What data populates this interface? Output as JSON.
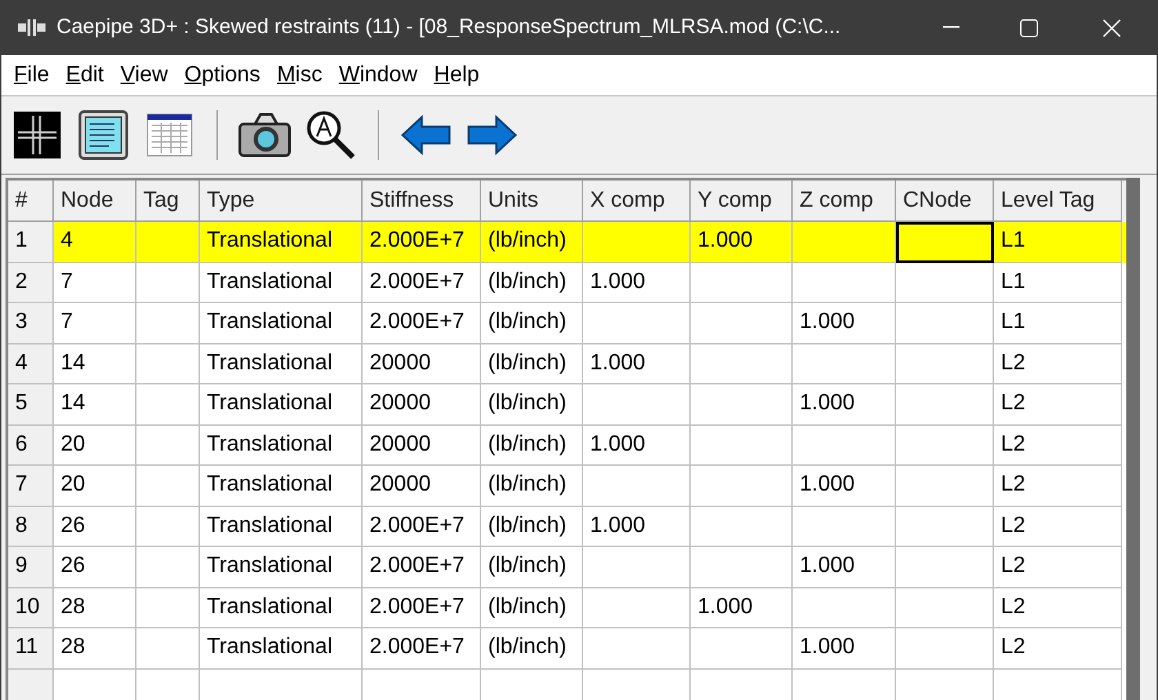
{
  "window": {
    "title": "Caepipe 3D+ : Skewed restraints  (11)  -  [08_ResponseSpectrum_MLRSA.mod (C:\\C..."
  },
  "menu": [
    "File",
    "Edit",
    "View",
    "Options",
    "Misc",
    "Window",
    "Help"
  ],
  "toolbar": [
    {
      "kind": "grid"
    },
    {
      "kind": "list"
    },
    {
      "kind": "table"
    },
    {
      "kind": "sep"
    },
    {
      "kind": "camera"
    },
    {
      "kind": "zoom"
    },
    {
      "kind": "sep"
    },
    {
      "kind": "back"
    },
    {
      "kind": "forward"
    }
  ],
  "table": {
    "columns": [
      "#",
      "Node",
      "Tag",
      "Type",
      "Stiffness",
      "Units",
      "X comp",
      "Y comp",
      "Z comp",
      "CNode",
      "Level Tag"
    ],
    "rows": [
      {
        "selected": true,
        "cells": [
          "1",
          "4",
          "",
          "Translational",
          "2.000E+7",
          "(lb/inch)",
          "",
          "1.000",
          "",
          "",
          "L1"
        ],
        "cell_focus": [
          false,
          false,
          false,
          false,
          false,
          false,
          false,
          false,
          false,
          true,
          false
        ]
      },
      {
        "selected": false,
        "cells": [
          "2",
          "7",
          "",
          "Translational",
          "2.000E+7",
          "(lb/inch)",
          "1.000",
          "",
          "",
          "",
          "L1"
        ]
      },
      {
        "selected": false,
        "cells": [
          "3",
          "7",
          "",
          "Translational",
          "2.000E+7",
          "(lb/inch)",
          "",
          "",
          "1.000",
          "",
          "L1"
        ]
      },
      {
        "selected": false,
        "cells": [
          "4",
          "14",
          "",
          "Translational",
          "20000",
          "(lb/inch)",
          "1.000",
          "",
          "",
          "",
          "L2"
        ]
      },
      {
        "selected": false,
        "cells": [
          "5",
          "14",
          "",
          "Translational",
          "20000",
          "(lb/inch)",
          "",
          "",
          "1.000",
          "",
          "L2"
        ]
      },
      {
        "selected": false,
        "cells": [
          "6",
          "20",
          "",
          "Translational",
          "20000",
          "(lb/inch)",
          "1.000",
          "",
          "",
          "",
          "L2"
        ]
      },
      {
        "selected": false,
        "cells": [
          "7",
          "20",
          "",
          "Translational",
          "20000",
          "(lb/inch)",
          "",
          "",
          "1.000",
          "",
          "L2"
        ]
      },
      {
        "selected": false,
        "cells": [
          "8",
          "26",
          "",
          "Translational",
          "2.000E+7",
          "(lb/inch)",
          "1.000",
          "",
          "",
          "",
          "L2"
        ]
      },
      {
        "selected": false,
        "cells": [
          "9",
          "26",
          "",
          "Translational",
          "2.000E+7",
          "(lb/inch)",
          "",
          "",
          "1.000",
          "",
          "L2"
        ]
      },
      {
        "selected": false,
        "cells": [
          "10",
          "28",
          "",
          "Translational",
          "2.000E+7",
          "(lb/inch)",
          "",
          "1.000",
          "",
          "",
          "L2"
        ]
      },
      {
        "selected": false,
        "cells": [
          "11",
          "28",
          "",
          "Translational",
          "2.000E+7",
          "(lb/inch)",
          "",
          "",
          "1.000",
          "",
          "L2"
        ]
      }
    ]
  }
}
